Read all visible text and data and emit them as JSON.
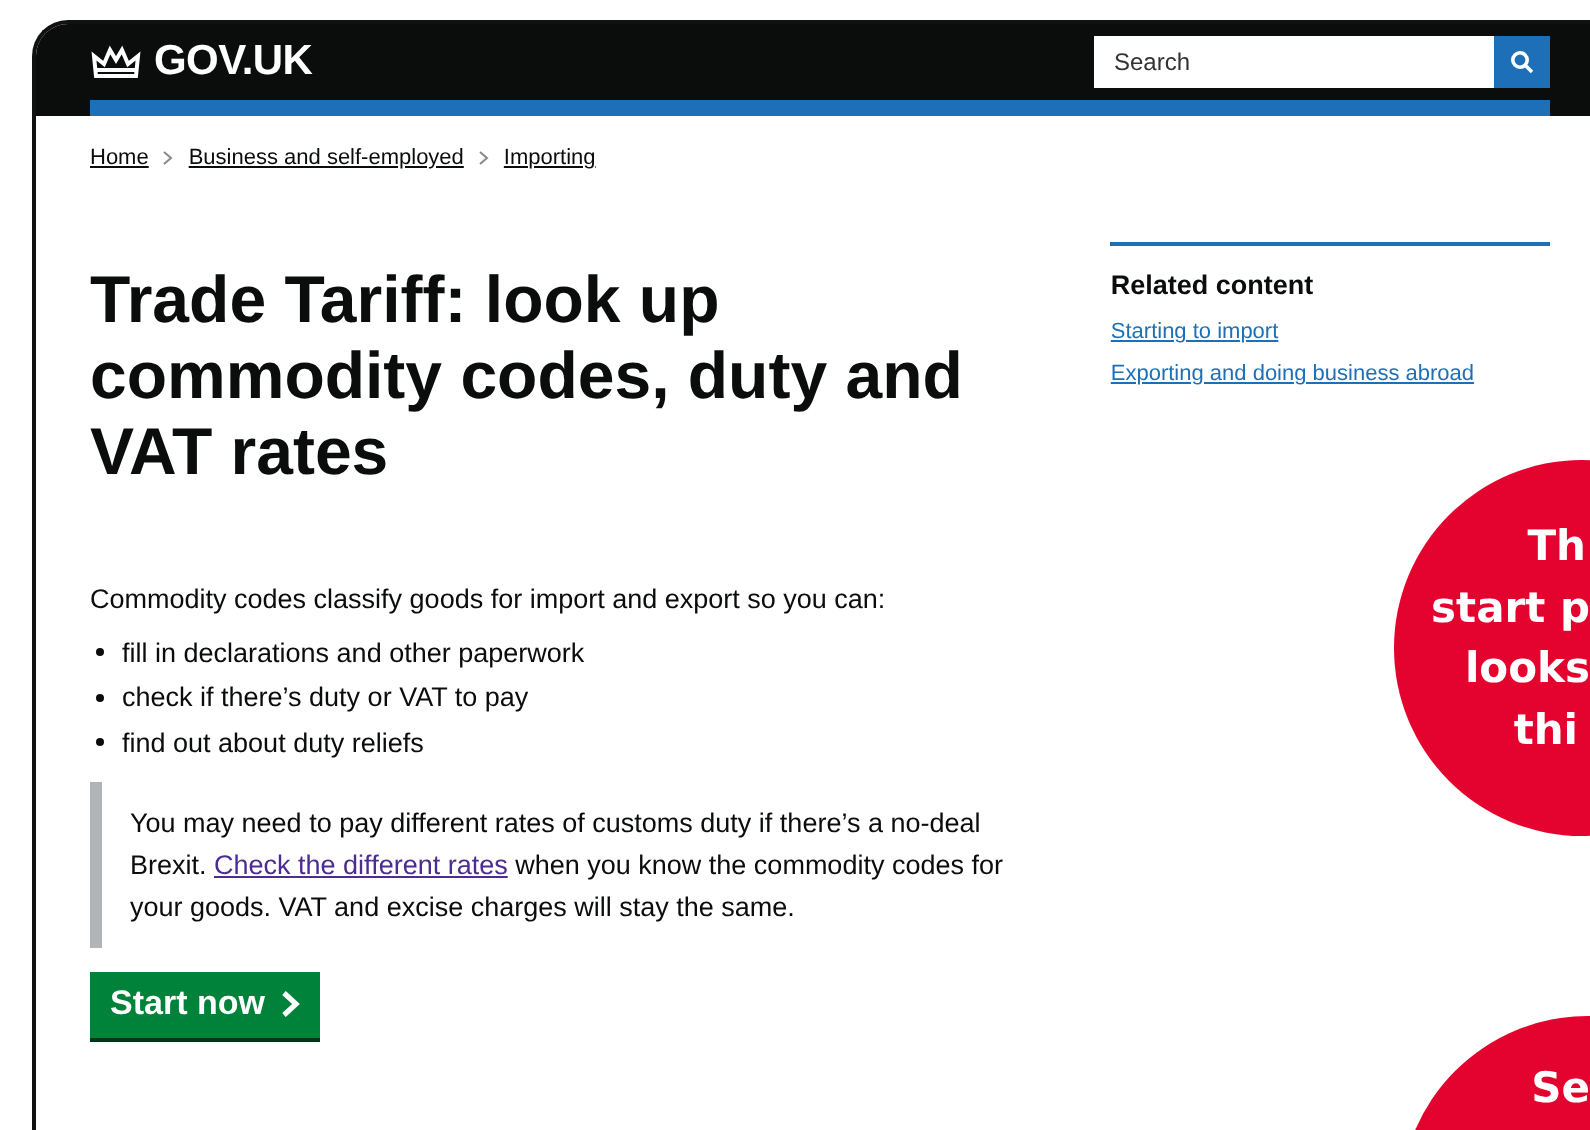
{
  "header": {
    "logo": "GOV.UK",
    "search": {
      "placeholder": "Search"
    }
  },
  "breadcrumbs": [
    {
      "label": "Home"
    },
    {
      "label": "Business and self-employed"
    },
    {
      "label": "Importing"
    }
  ],
  "title": "Trade Tariff: look up commodity codes, duty and VAT rates",
  "intro": "Commodity codes classify goods for import and export so you can:",
  "bullets": [
    "fill in declarations and other paperwork",
    "check if there’s duty or VAT to pay",
    "find out about duty reliefs"
  ],
  "inset": {
    "before": "You may need to pay different rates of customs duty if there’s a no-deal Brexit.",
    "link": "Check the different rates",
    "after": "when you know the commodity codes for your goods. VAT and excise charges will stay the same."
  },
  "start_button": {
    "label": "Start now"
  },
  "related": {
    "heading": "Related content",
    "links": [
      "Starting to import",
      "Exporting and doing business abroad"
    ]
  },
  "callouts": [
    {
      "lines": [
        "Th",
        "start p",
        "looks",
        "thi"
      ]
    },
    {
      "lines": [
        "Se"
      ]
    }
  ]
}
